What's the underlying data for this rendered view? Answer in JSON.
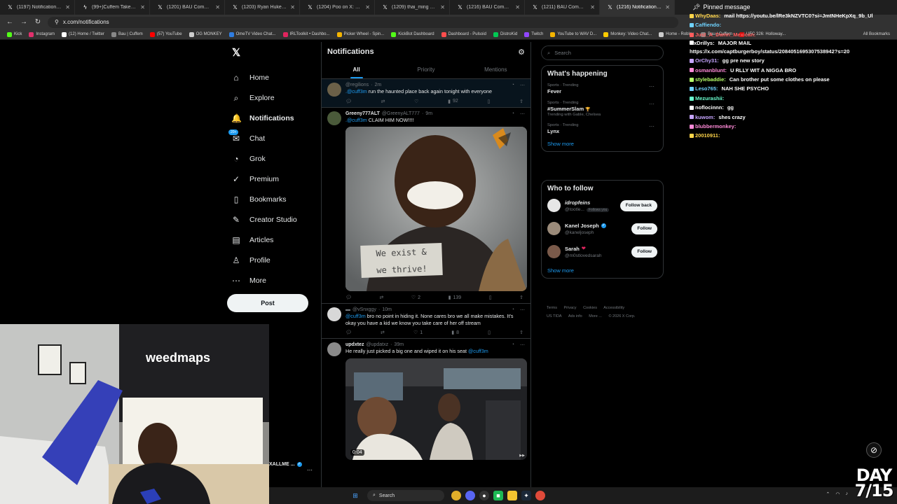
{
  "browser": {
    "tabs": [
      {
        "title": "(1197) Notifications / X",
        "icon": "x-logo-icon",
        "active": false
      },
      {
        "title": "(99+)Cuffem Takes Break A...",
        "icon": "kick-icon",
        "active": false
      },
      {
        "title": "(1201) BAU Community / X",
        "icon": "x-logo-icon",
        "active": false
      },
      {
        "title": "(1203) Ryan Hukery on X: '",
        "icon": "x-logo-icon",
        "active": false
      },
      {
        "title": "(1204) Poo on X: \"https://t...",
        "icon": "x-logo-icon",
        "active": false
      },
      {
        "title": "(1209) thai_ming on X:",
        "icon": "x-logo-icon",
        "active": false
      },
      {
        "title": "(1216) BAU Community / X",
        "icon": "x-logo-icon",
        "active": false
      },
      {
        "title": "(1211) BAU Community / X",
        "icon": "x-logo-icon",
        "active": false
      },
      {
        "title": "(1216) Notifications / X",
        "icon": "x-logo-icon",
        "active": true
      }
    ],
    "url": "x.com/notifications",
    "bookmarks": [
      {
        "label": "Kick",
        "color": "#53fc18"
      },
      {
        "label": "Instagram",
        "color": "#e1306c"
      },
      {
        "label": "(12) Home / Twitter",
        "color": "#ffffff"
      },
      {
        "label": "Bau | Cuffem",
        "color": "#888888"
      },
      {
        "label": "(57) YouTube",
        "color": "#ff0000"
      },
      {
        "label": "OG MONKEY",
        "color": "#cccccc"
      },
      {
        "label": "OmeTV Video Chat...",
        "color": "#2f7de1"
      },
      {
        "label": "IRLToolkit • Dashbo...",
        "color": "#e0245e"
      },
      {
        "label": "Picker Wheel - Spin...",
        "color": "#f4b400"
      },
      {
        "label": "KickBot Dashboard",
        "color": "#53fc18"
      },
      {
        "label": "Dashboard - Pulsoid",
        "color": "#ff4d4d"
      },
      {
        "label": "DistroKid",
        "color": "#00c853"
      },
      {
        "label": "Twitch",
        "color": "#9146ff"
      },
      {
        "label": "YouTube to WAV D...",
        "color": "#f4b400"
      },
      {
        "label": "Monkey: Video Chat...",
        "color": "#ffcc00"
      },
      {
        "label": "Home - Roblox",
        "color": "#cccccc"
      },
      {
        "label": "Bau | Cuffem",
        "color": "#888888"
      },
      {
        "label": "UFC 326: Holloway...",
        "color": "#d20a0a"
      }
    ],
    "all_bookmarks": "All Bookmarks"
  },
  "xnav": {
    "items": [
      {
        "label": "Home",
        "icon": "home-icon",
        "glyph": "⌂",
        "active": false,
        "name": "nav-home"
      },
      {
        "label": "Explore",
        "icon": "search-icon",
        "glyph": "⌕",
        "active": false,
        "name": "nav-explore"
      },
      {
        "label": "Notifications",
        "icon": "bell-icon",
        "glyph": "🔔",
        "active": true,
        "name": "nav-notifications"
      },
      {
        "label": "Chat",
        "icon": "chat-icon",
        "glyph": "✉",
        "active": false,
        "name": "nav-chat",
        "badge": "20+"
      },
      {
        "label": "Grok",
        "icon": "grok-icon",
        "glyph": "◔",
        "active": false,
        "name": "nav-grok"
      },
      {
        "label": "Premium",
        "icon": "premium-icon",
        "glyph": "✓",
        "active": false,
        "name": "nav-premium"
      },
      {
        "label": "Bookmarks",
        "icon": "bookmark-icon",
        "glyph": "▯",
        "active": false,
        "name": "nav-bookmarks"
      },
      {
        "label": "Creator Studio",
        "icon": "creator-studio-icon",
        "glyph": "✎",
        "active": false,
        "name": "nav-creator-studio"
      },
      {
        "label": "Articles",
        "icon": "articles-icon",
        "glyph": "▤",
        "active": false,
        "name": "nav-articles"
      },
      {
        "label": "Profile",
        "icon": "profile-icon",
        "glyph": "♙",
        "active": false,
        "name": "nav-profile"
      },
      {
        "label": "More",
        "icon": "more-icon",
        "glyph": "⋯",
        "active": false,
        "name": "nav-more"
      }
    ],
    "post_label": "Post"
  },
  "feed": {
    "title": "Notifications",
    "tabs": [
      "All",
      "Priority",
      "Mentions"
    ],
    "tweets": [
      {
        "name": "",
        "handle": "@regilions",
        "time": "2m",
        "mention": ".@cuff3m",
        "text": " run the haunted place back again tonight with everyone",
        "reply": "",
        "retweet": "",
        "like": "",
        "views": "92",
        "avatar_color": "#6b6048"
      },
      {
        "name": "Greeny777ALT",
        "handle": "@GreenyALT777",
        "time": "9m",
        "mention": ".@cuff3m",
        "text": " CLAIM HIM NOW!!!!",
        "reply": "",
        "retweet": "",
        "like": "2",
        "views": "139",
        "avatar_color": "#4a5a3a",
        "sign_line1": "We exist &",
        "sign_line2": "we thrive!"
      },
      {
        "name": "",
        "handle": "@vSnxggy",
        "time": "10m",
        "mention": "@cuff3m",
        "text": " bro no point in hiding it. None cares bro we all make mistakes. It's okay you have a kid we know you take care of her off stream",
        "reply": "",
        "retweet": "",
        "like": "1",
        "views": "8",
        "avatar_color": "#d8d8d8"
      },
      {
        "name": "updxtez",
        "handle": "@updatxz",
        "time": "39m",
        "mention": "@cuff3m",
        "text": "He really just picked a big one and wiped it on his seat ",
        "video_time": "0:04",
        "avatar_color": "#8a8a8a"
      }
    ]
  },
  "sidebar": {
    "search_placeholder": "Search",
    "happening_title": "What's happening",
    "trends": [
      {
        "category": "Sports · Trending",
        "name": "Fever",
        "sub": ""
      },
      {
        "category": "Sports · Trending",
        "name": "#SummerSlam",
        "sub": "Trending with Gable, Chelsea"
      },
      {
        "category": "Sports · Trending",
        "name": "Lynx",
        "sub": ""
      }
    ],
    "show_more": "Show more",
    "wtf_title": "Who to follow",
    "wtf": [
      {
        "name": "idropfeins",
        "handle": "@tootle...",
        "follows_you": "Follows you",
        "button": "Follow back",
        "verified": false,
        "avatar_color": "#e6e6e6"
      },
      {
        "name": "Kanel Joseph",
        "handle": "@kaneljoseph",
        "follows_you": "",
        "button": "Follow",
        "verified": true,
        "avatar_color": "#9b8b7a"
      },
      {
        "name": "Sarah",
        "handle": "@m0stlovedsarah",
        "follows_you": "",
        "button": "Follow",
        "verified": false,
        "avatar_color": "#7a5a4a"
      }
    ],
    "wtf_show_more": "Show more",
    "footer": [
      "Terms",
      "Privacy",
      "Cookies",
      "Accessibility",
      "Ads info",
      "More ...",
      "© 2026 X Corp."
    ],
    "footer_usa": "US TIDA"
  },
  "chat": {
    "pinned": "Pinned message",
    "lines": [
      {
        "user": "WhyDaas:",
        "color": "#ffd54a",
        "msg": "mail https://youtu.be/lRe3kNZVTC0?si=JmtNHeKpXq_9b_Ul"
      },
      {
        "user": "Caffiendo:",
        "color": "#6fd3ff",
        "msg": ""
      },
      {
        "user": "Just_A_Damn_Mexican:",
        "color": "#ff5d5d",
        "msg": ""
      },
      {
        "user": "xDrillys:",
        "color": "#ffffff",
        "msg": "MAJOR MAIL https://x.com/captburgerboy/status/2084051695307538942?s=20"
      },
      {
        "user": "OrChy31:",
        "color": "#c6a5ff",
        "msg": "gg pre new story"
      },
      {
        "user": "osmanblunt:",
        "color": "#ff8ad8",
        "msg": "U RLLY WIT A NIGGA BRO"
      },
      {
        "user": "stylebaddie:",
        "color": "#b6ff6a",
        "msg": "Can brother put some clothes on please"
      },
      {
        "user": "Leso765:",
        "color": "#6fd3ff",
        "msg": "NAH SHE PSYCHO"
      },
      {
        "user": "Mezurashii:",
        "color": "#6affd0",
        "msg": ""
      },
      {
        "user": "noflocinnn:",
        "color": "#ffffff",
        "msg": "gg"
      },
      {
        "user": "kuwom:",
        "color": "#c6a5ff",
        "msg": "shes crazy"
      },
      {
        "user": "blubbermonkey:",
        "color": "#ff8ad8",
        "msg": ""
      },
      {
        "user": "20010911:",
        "color": "#ffd54a",
        "msg": ""
      }
    ]
  },
  "webcam": {
    "sign_text": "weedmaps",
    "footer_name": "XALLME ..."
  },
  "taskbar": {
    "search_label": "Search"
  },
  "overlay": {
    "day_line1": "DAY",
    "day_line2": "7/15"
  }
}
